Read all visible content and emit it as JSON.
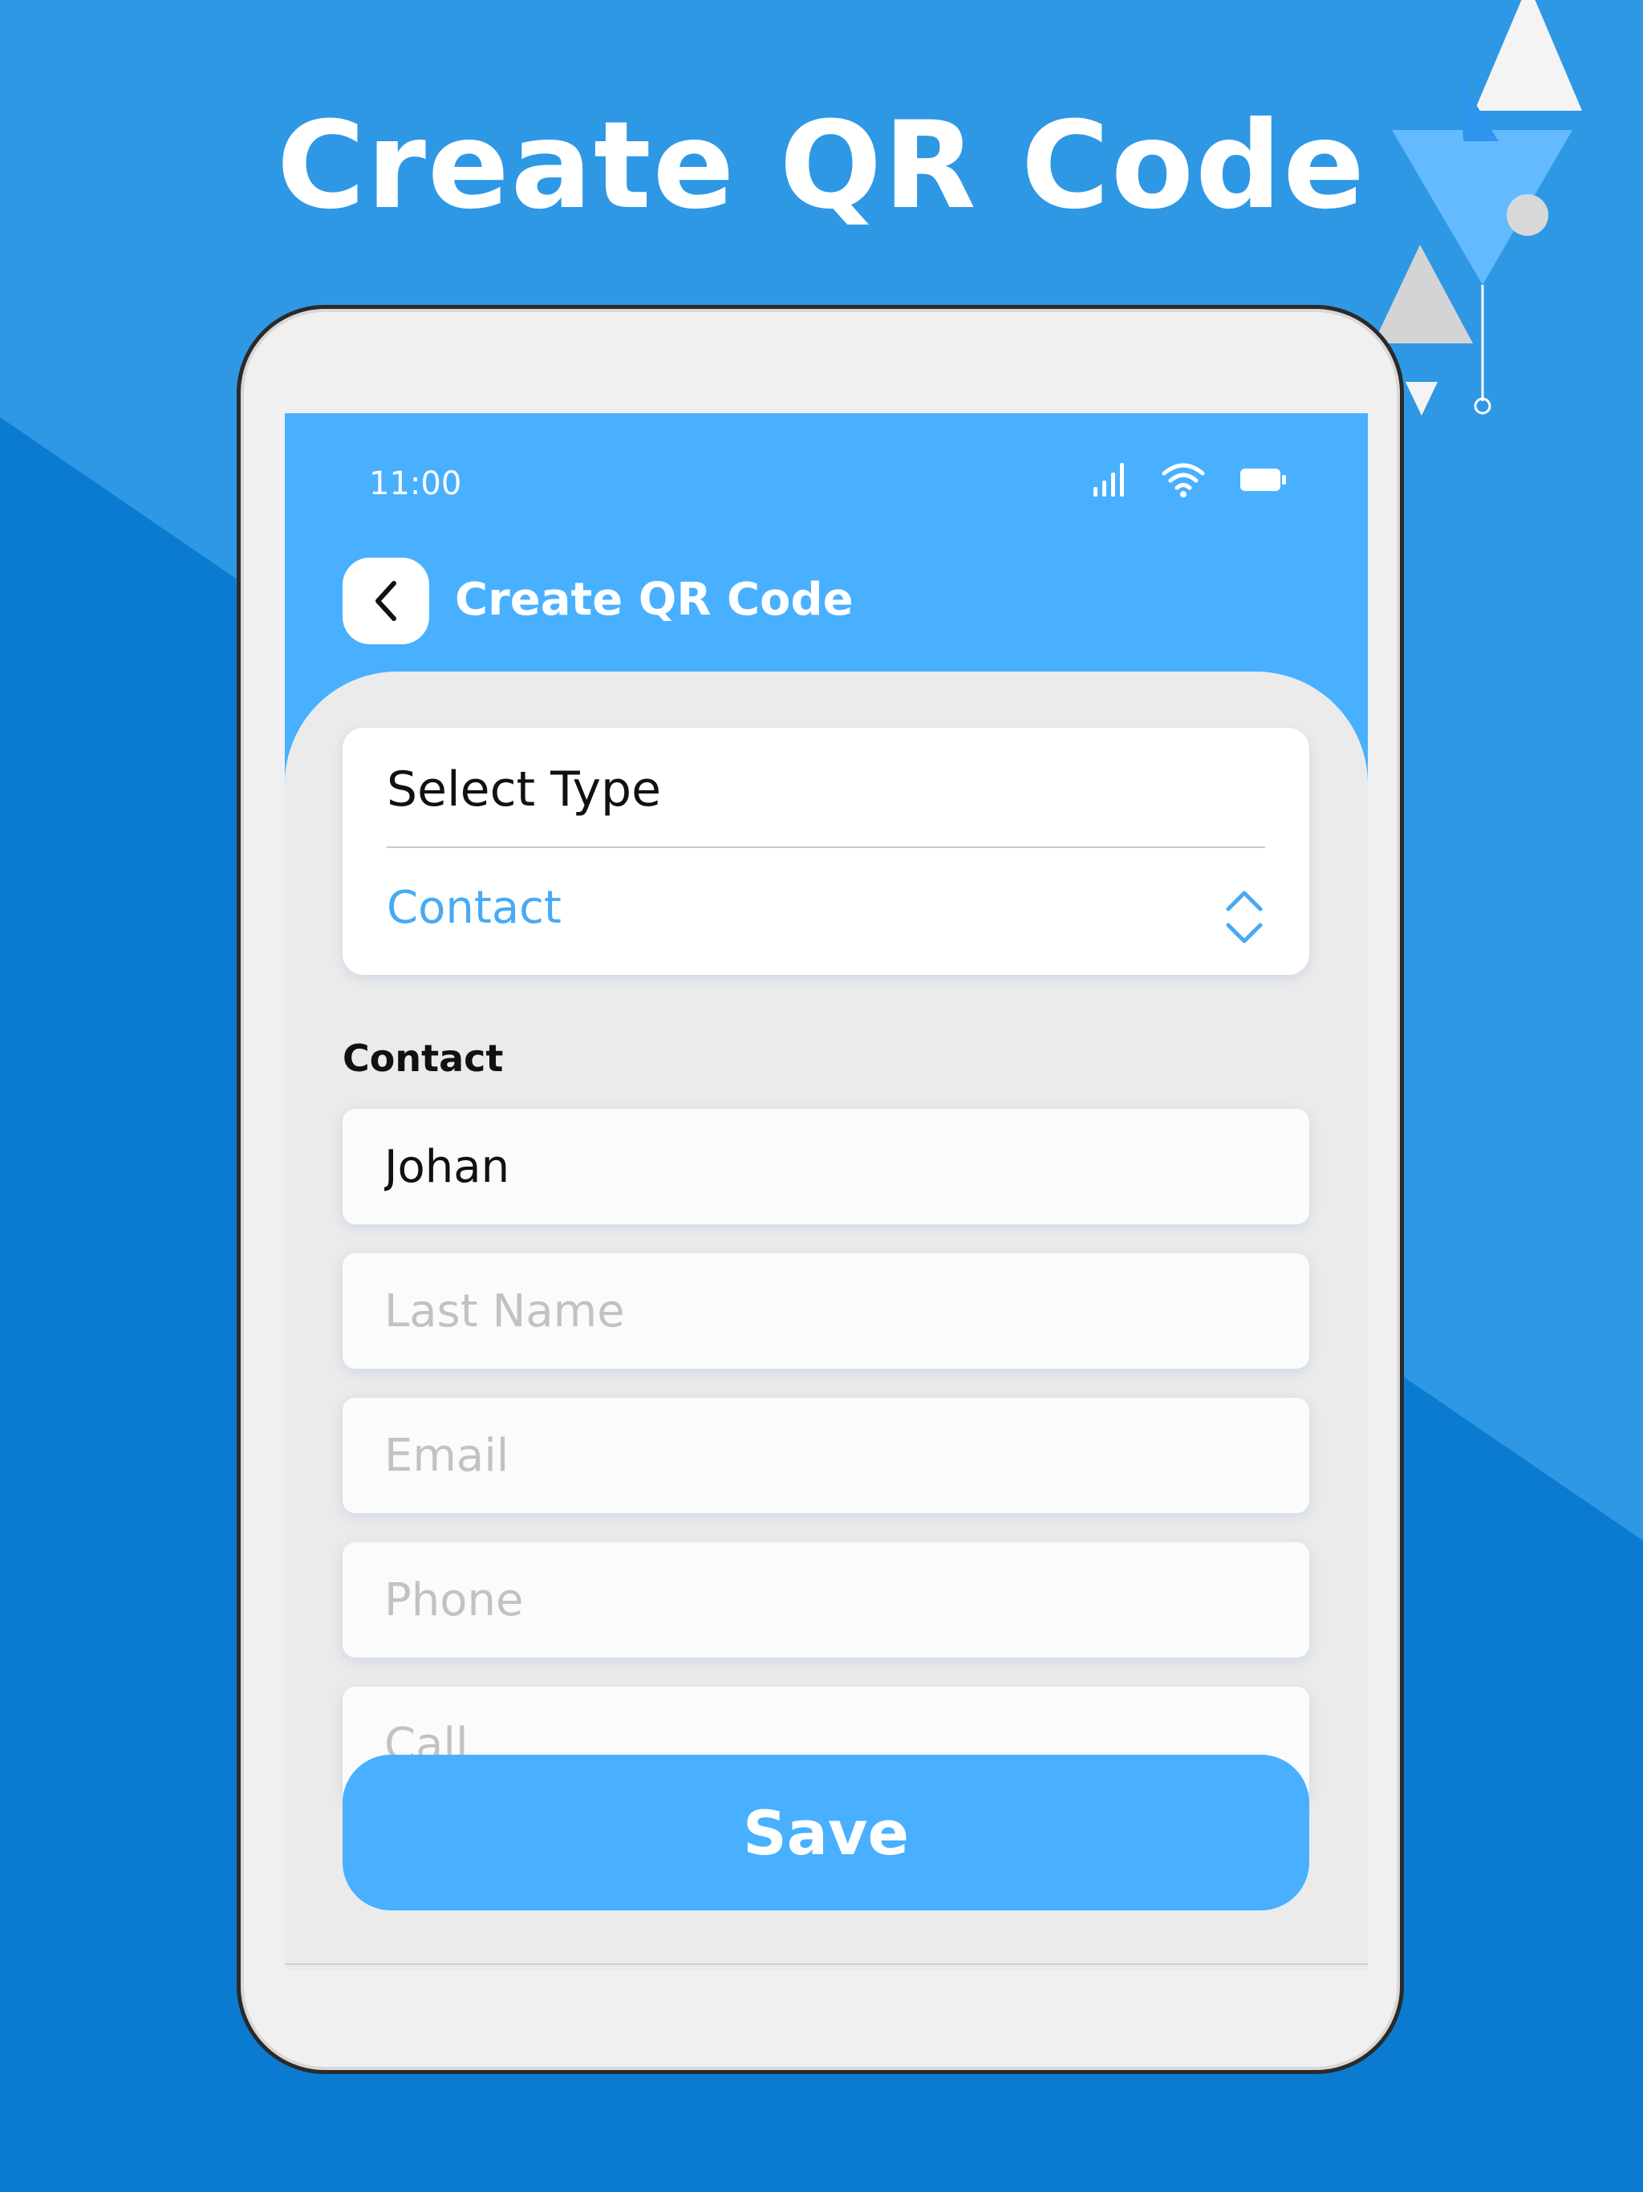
{
  "promo": {
    "headline": "Create QR Code"
  },
  "status_bar": {
    "time": "11:00",
    "icons": [
      "signal-icon",
      "wifi-icon",
      "battery-icon"
    ]
  },
  "app_bar": {
    "back_icon": "chevron-left-icon",
    "title": "Create QR Code"
  },
  "type_selector": {
    "label": "Select Type",
    "selected": "Contact",
    "icon": "chevron-up-down-icon"
  },
  "contact_form": {
    "section_label": "Contact",
    "first_name": {
      "value": "Johan",
      "placeholder": ""
    },
    "last_name": {
      "value": "",
      "placeholder": "Last Name"
    },
    "email": {
      "value": "",
      "placeholder": "Email"
    },
    "phone": {
      "value": "",
      "placeholder": "Phone"
    },
    "call": {
      "value": "",
      "placeholder": "Call"
    }
  },
  "actions": {
    "save_label": "Save"
  },
  "colors": {
    "background_dark": "#0a7bd0",
    "background_light": "#2e98e5",
    "accent": "#48b0ff",
    "accent_text": "#48aaf5",
    "placeholder": "#c2c2c2"
  }
}
